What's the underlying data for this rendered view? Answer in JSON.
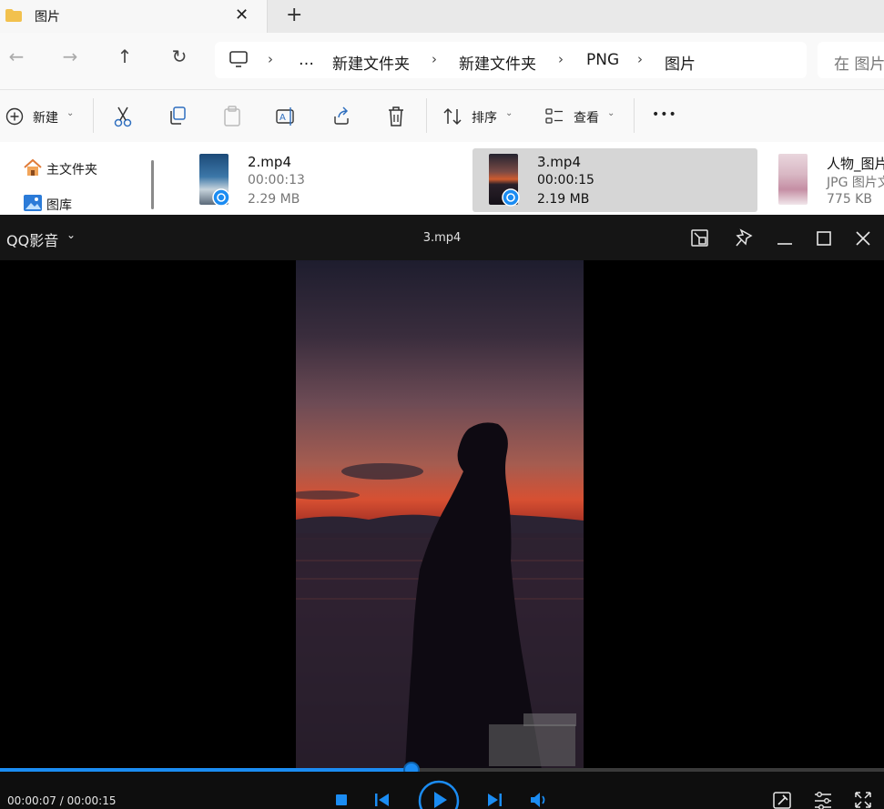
{
  "explorer": {
    "tab_title": "图片",
    "tab_close": "✕",
    "new_tab": "+",
    "nav": {
      "back": "←",
      "forward": "→",
      "up": "↑",
      "refresh": "↻"
    },
    "breadcrumb": {
      "expand": "…",
      "items": [
        "新建文件夹",
        "新建文件夹",
        "PNG",
        "图片"
      ],
      "separator": "›"
    },
    "search_placeholder": "在 图片",
    "commands": {
      "new_label": "新建",
      "sort_label": "排序",
      "view_label": "查看",
      "more": "•••"
    },
    "sidebar": [
      {
        "label": "主文件夹",
        "icon": "home-icon"
      },
      {
        "label": "图库",
        "icon": "gallery-icon"
      }
    ],
    "files": [
      {
        "name": "2.mp4",
        "line2": "00:00:13",
        "line3": "2.29 MB",
        "type": "video"
      },
      {
        "name": "3.mp4",
        "line2": "00:00:15",
        "line3": "2.19 MB",
        "type": "video",
        "selected": true
      },
      {
        "name": "人物_图片",
        "line2": "JPG 图片文",
        "line3": "775 KB",
        "type": "image"
      }
    ]
  },
  "player": {
    "app_name": "QQ影音",
    "video_title": "3.mp4",
    "time_current": "00:00:07",
    "time_total": "00:00:15",
    "time_display": "00:00:07 / 00:00:15",
    "progress_fraction": 0.466,
    "accent_color": "#1b8cf2"
  }
}
